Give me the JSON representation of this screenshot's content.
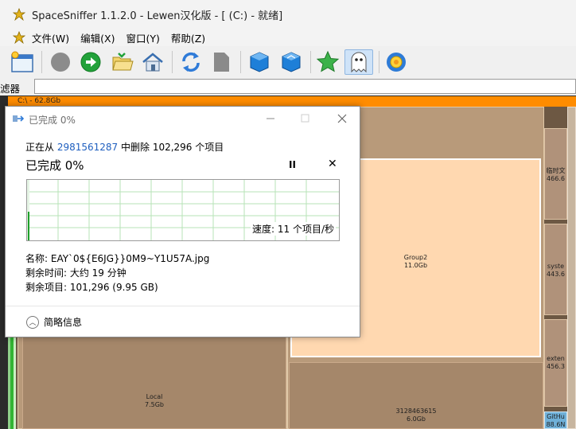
{
  "window": {
    "title": "SpaceSniffer 1.1.2.0 - Lewen汉化版 - [ (C:) - 就绪]"
  },
  "menu": {
    "items": [
      "文件(W)",
      "编辑(X)",
      "窗口(Y)",
      "帮助(Z)"
    ]
  },
  "toolbar": {
    "buttons": [
      "new-window-icon",
      "stop-icon",
      "go-icon",
      "open-folder-icon",
      "home-icon",
      "refresh-icon",
      "document-icon",
      "blue-cube-icon",
      "blue-cube-2-icon",
      "star-icon",
      "ghost-icon",
      "gear-flower-icon"
    ]
  },
  "filter": {
    "label": "滤器",
    "value": ""
  },
  "treemap": {
    "drive_label": "C:\\ - 62.8Gb",
    "blocks": {
      "group2_name": "Group2",
      "group2_size": "11.0Gb",
      "local_name": "Local",
      "local_size": "7.5Gb",
      "num_name": "3128463615",
      "num_size": "6.0Gb",
      "r1_name": "临时文",
      "r1_size": "466.6",
      "r2_name": "syste",
      "r2_size": "443.6",
      "r3_name": "exten",
      "r3_size": "456.3",
      "r4_name": "GitHu",
      "r4_size": "88.6N"
    },
    "colors": {
      "drive": "#ff8c00",
      "selected": "#ffd8b0",
      "dark": "#7a6048"
    }
  },
  "dialog": {
    "title": "已完成 0%",
    "line1_prefix": "正在从 ",
    "line1_link": "2981561287",
    "line1_suffix": " 中删除 102,296 个项目",
    "heading": "已完成 0%",
    "pause": "II",
    "stop": "✕",
    "speed": "速度: 11 个项目/秒",
    "name_line": "名称: EAY`0${E6JG}}0M9~Y1U57A.jpg",
    "time_line": "剩余时间: 大约 19 分钟",
    "items_line": "剩余项目: 101,296 (9.95 GB)",
    "less_info": "简略信息",
    "progress_percent": 0
  }
}
